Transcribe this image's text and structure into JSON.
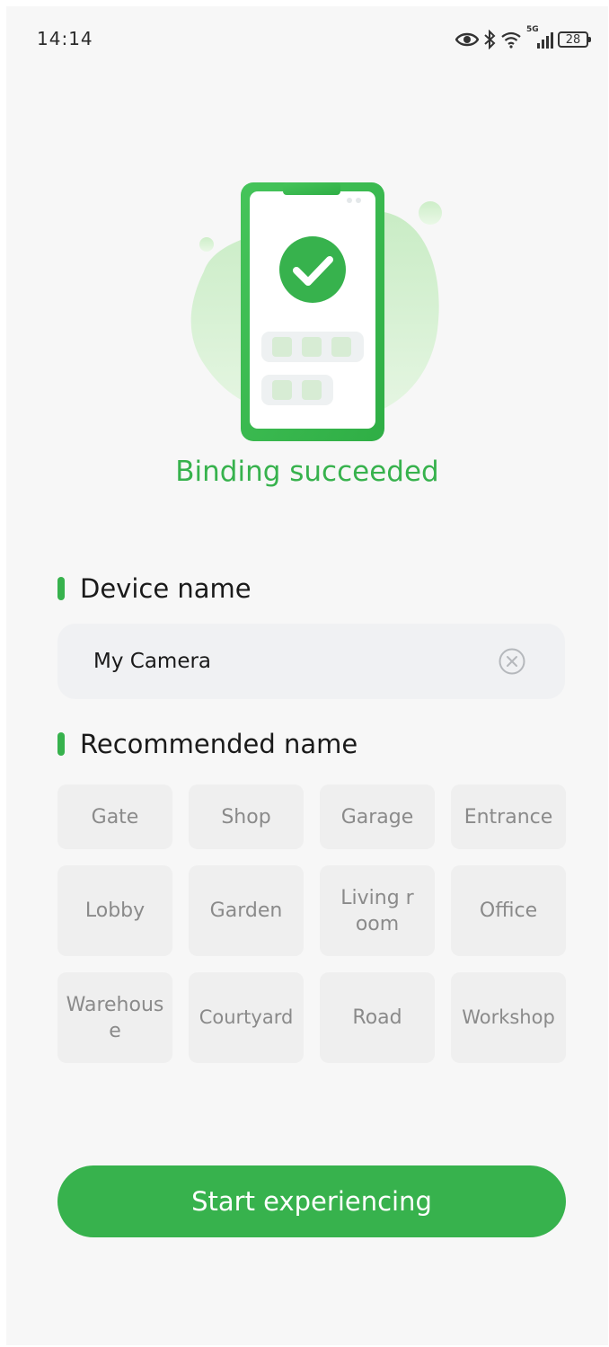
{
  "status_bar": {
    "time": "14:14",
    "network": "5G",
    "battery": "28",
    "icons": [
      "eye-icon",
      "bluetooth-icon",
      "wifi-icon",
      "cellular-signal-icon",
      "battery-icon"
    ]
  },
  "hero": {
    "illustration": "phone-check-illustration",
    "title": "Binding succeeded"
  },
  "device_name": {
    "heading": "Device name",
    "value": "My Camera",
    "clear_icon": "clear-circle-icon"
  },
  "recommended": {
    "heading": "Recommended name",
    "chips": [
      "Gate",
      "Shop",
      "Garage",
      "Entrance",
      "Lobby",
      "Garden",
      "Living room",
      "Office",
      "Warehouse",
      "Courtyard",
      "Road",
      "Workshop"
    ]
  },
  "actions": {
    "start_label": "Start experiencing"
  },
  "colors": {
    "accent": "#37b24d",
    "chip_bg": "#efefef",
    "chip_text": "#8a8a8a",
    "page_bg": "#f7f7f7"
  }
}
